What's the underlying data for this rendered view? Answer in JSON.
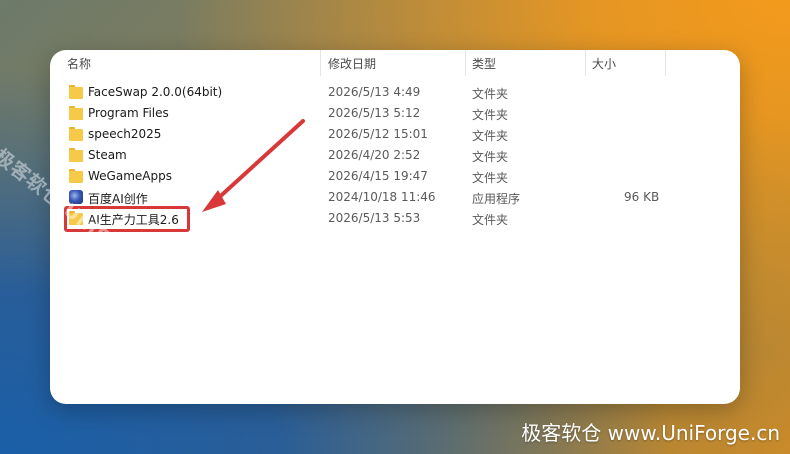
{
  "columns": {
    "name": "名称",
    "modified": "修改日期",
    "type": "类型",
    "size": "大小"
  },
  "files": [
    {
      "name": "FaceSwap 2.0.0(64bit)",
      "date": "2026/5/13 4:49",
      "type": "文件夹",
      "size": "",
      "icon": "folder-icon"
    },
    {
      "name": "Program Files",
      "date": "2026/5/13 5:12",
      "type": "文件夹",
      "size": "",
      "icon": "folder-icon"
    },
    {
      "name": "speech2025",
      "date": "2026/5/12 15:01",
      "type": "文件夹",
      "size": "",
      "icon": "folder-icon"
    },
    {
      "name": "Steam",
      "date": "2026/4/20 2:52",
      "type": "文件夹",
      "size": "",
      "icon": "folder-icon"
    },
    {
      "name": "WeGameApps",
      "date": "2026/4/15 19:47",
      "type": "文件夹",
      "size": "",
      "icon": "folder-icon"
    },
    {
      "name": "百度AI创作",
      "date": "2024/10/18 11:46",
      "type": "应用程序",
      "size": "96 KB",
      "icon": "app-icon"
    },
    {
      "name": "AI生产力工具2.6",
      "date": "2026/5/13 5:53",
      "type": "文件夹",
      "size": "",
      "icon": "folder-icon"
    }
  ],
  "annotation": {
    "color": "#d93838"
  },
  "watermark": {
    "diagonal": "极客软仓 UniForge.cn",
    "bottom": "极客软仓 www.UniForge.cn"
  }
}
